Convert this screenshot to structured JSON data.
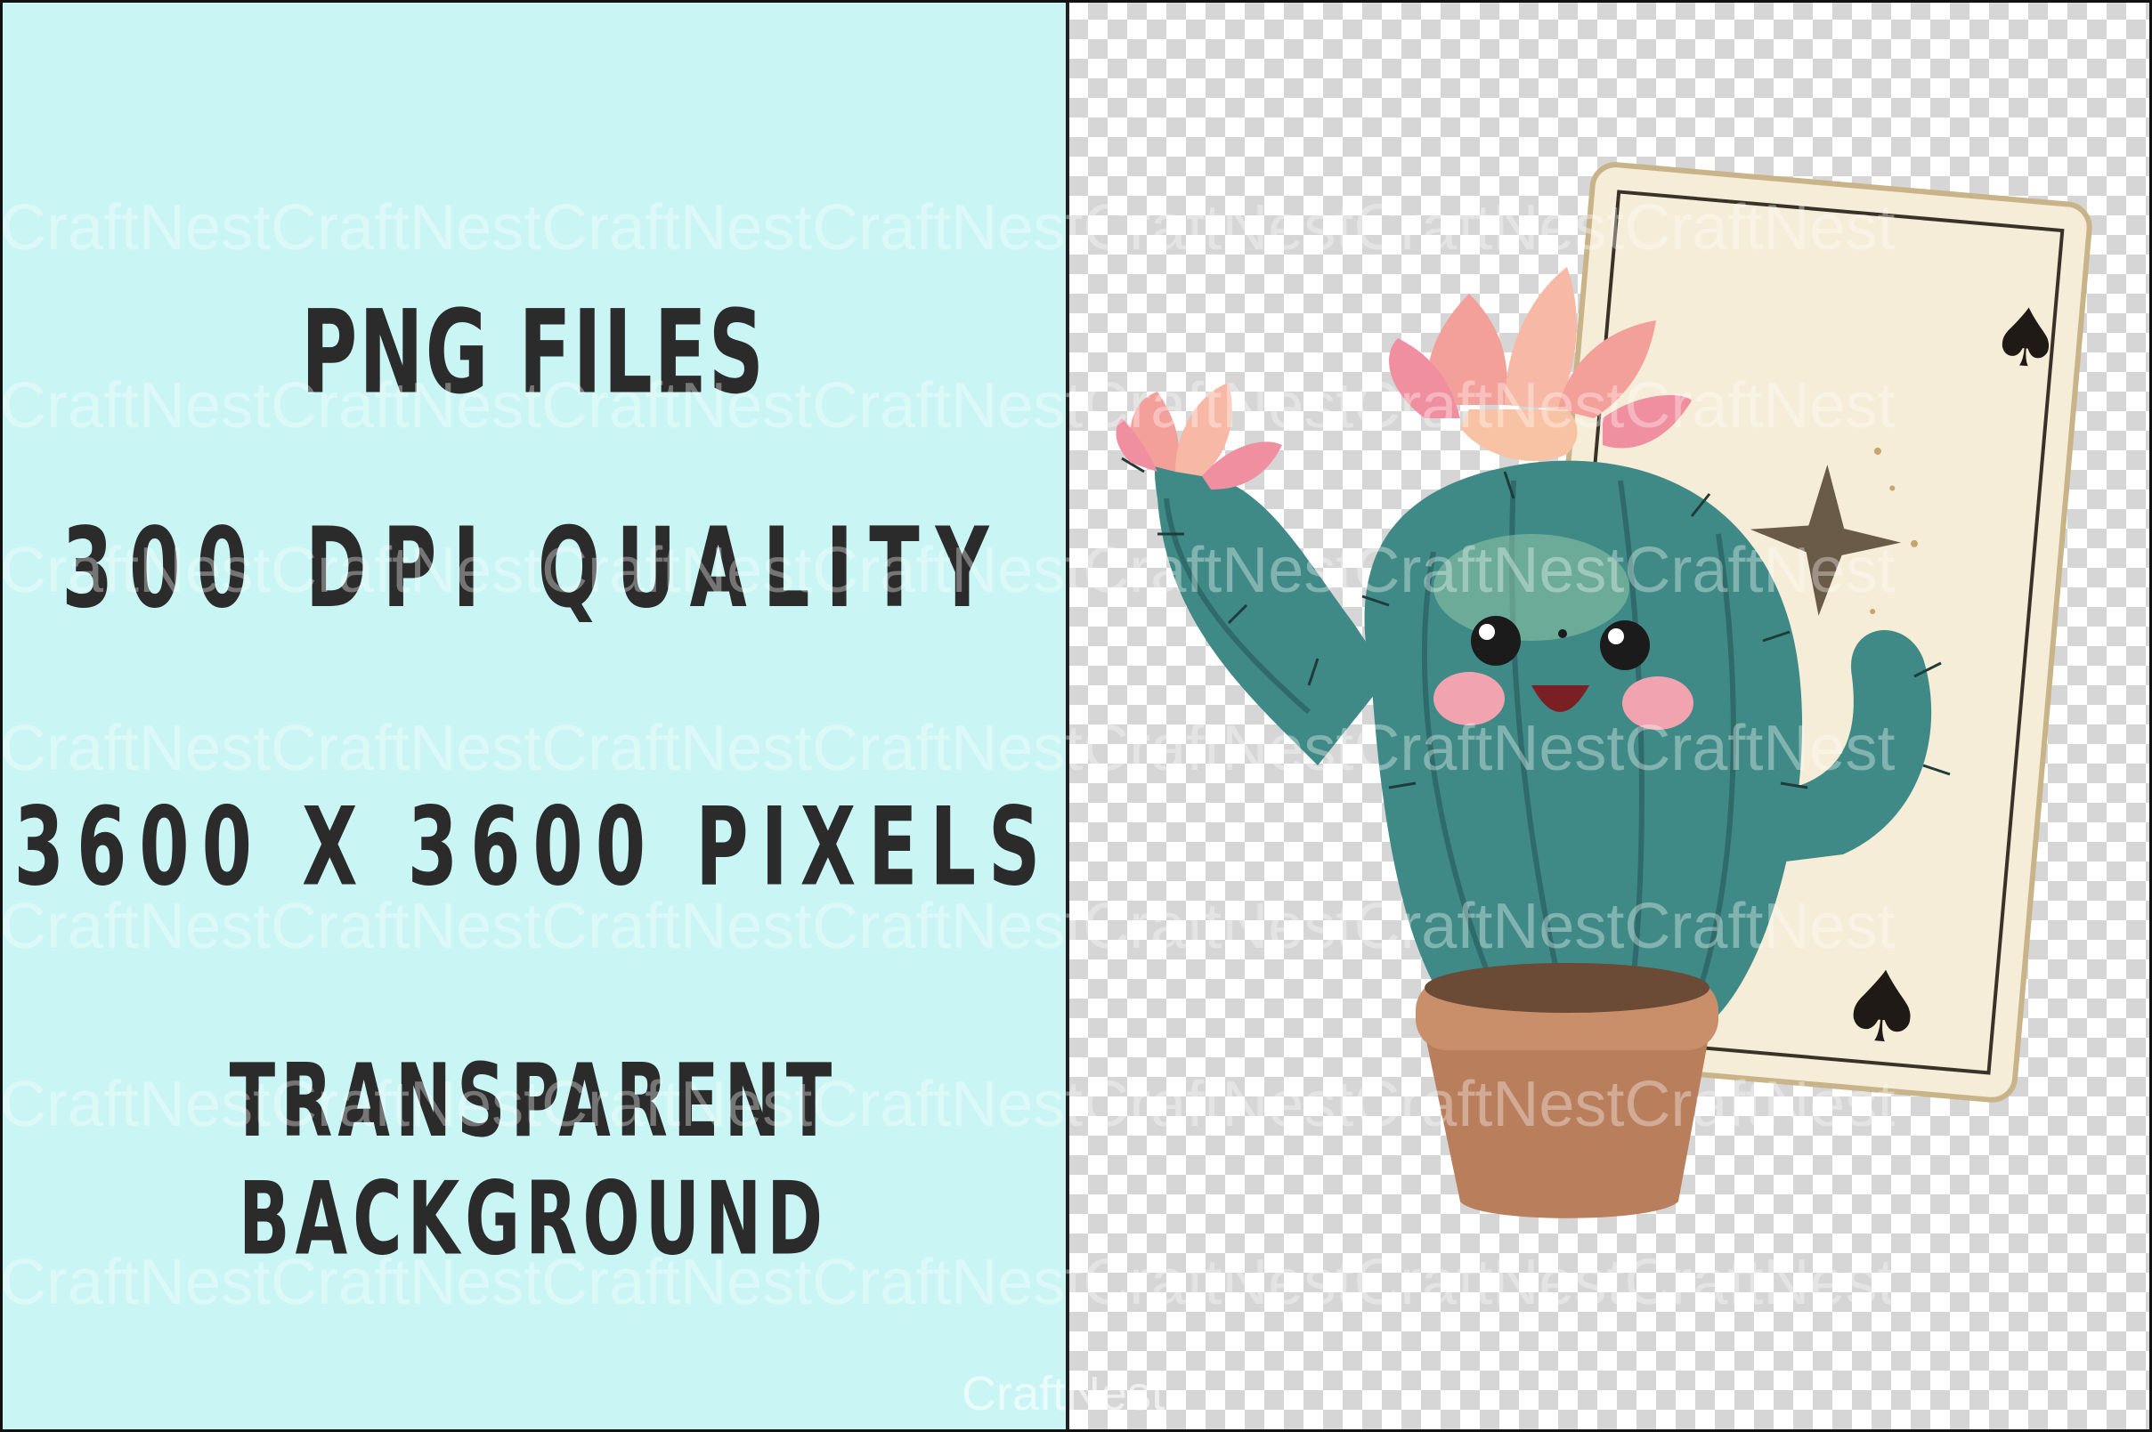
{
  "features": {
    "png_files": "PNG FILES",
    "dpi": "300 DPI QUALITY",
    "pixels": "3600 X 3600 PIXELS",
    "background": "TRANSPARENT BACKGROUND"
  },
  "watermark": {
    "row_text": "CraftNestCraftNestCraftNestCraftNestCraftNestCraftNestCraftNest",
    "bottom_text": "CraftNest"
  },
  "colors": {
    "left_panel_bg": "#c9f6f4",
    "heading_text": "#2b2b2b",
    "cactus": "#3f8a86",
    "flower": "#f4a09a",
    "pot": "#b97f5c",
    "card": "#f5edd7"
  },
  "illustration": {
    "subject": "cactus-in-pot-with-spade-playing-card",
    "card_symbol": "♠"
  }
}
